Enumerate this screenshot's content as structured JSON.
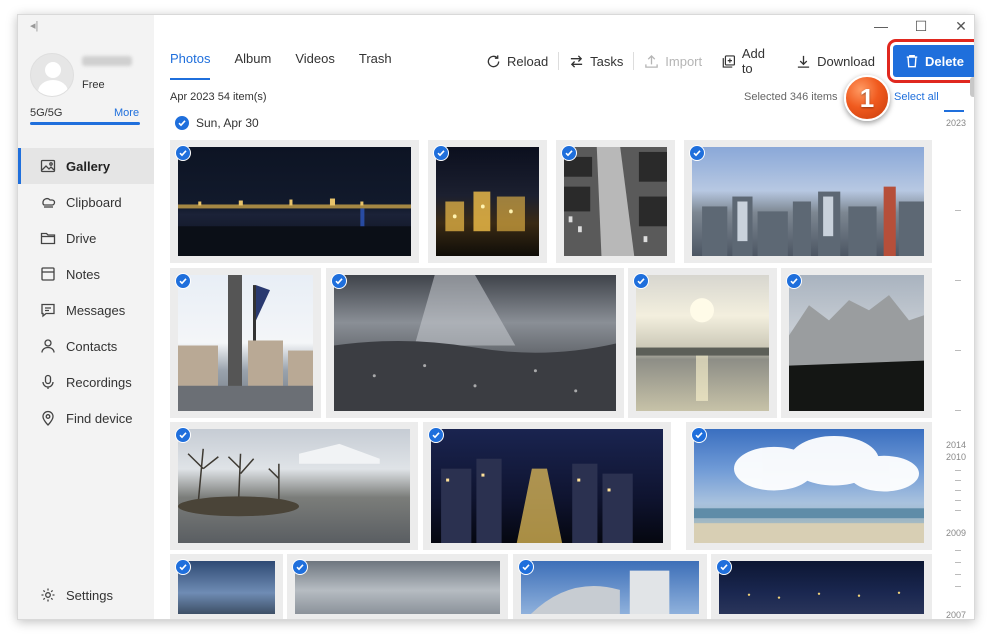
{
  "sidebar": {
    "plan": "Free",
    "storage_label": "5G/5G",
    "storage_more": "More",
    "storage_used_fraction": 1.0,
    "nav": [
      {
        "label": "Gallery",
        "icon": "gallery-icon",
        "active": true
      },
      {
        "label": "Clipboard",
        "icon": "clipboard-icon"
      },
      {
        "label": "Drive",
        "icon": "folder-icon"
      },
      {
        "label": "Notes",
        "icon": "notes-icon"
      },
      {
        "label": "Messages",
        "icon": "message-icon"
      },
      {
        "label": "Contacts",
        "icon": "person-icon"
      },
      {
        "label": "Recordings",
        "icon": "microphone-icon"
      },
      {
        "label": "Find device",
        "icon": "location-icon"
      }
    ],
    "settings_label": "Settings"
  },
  "tabs": [
    {
      "label": "Photos",
      "active": true
    },
    {
      "label": "Album"
    },
    {
      "label": "Videos"
    },
    {
      "label": "Trash"
    }
  ],
  "toolbar": {
    "reload": "Reload",
    "tasks": "Tasks",
    "import": "Import",
    "add_to": "Add to",
    "download": "Download",
    "delete": "Delete"
  },
  "annotation_number": "1",
  "summary": {
    "month_count": "Apr 2023 54 item(s)",
    "selected": "Selected 346 items",
    "select_all": "Select all"
  },
  "date_group": "Sun, Apr 30",
  "timeline_years": [
    "2023",
    "2014",
    "2010",
    "2009",
    "2007"
  ],
  "colors": {
    "accent": "#1f6fdc",
    "annotation_outline": "#e0281f",
    "annotation_badge": "#f05a1e"
  },
  "photos": [
    {
      "subject": "night city skyline by water"
    },
    {
      "subject": "night buildings lights"
    },
    {
      "subject": "aerial street black and white"
    },
    {
      "subject": "city skyline with towers"
    },
    {
      "subject": "harbor street with flags"
    },
    {
      "subject": "cloudy landscape panorama"
    },
    {
      "subject": "sunset over lake"
    },
    {
      "subject": "rocky mountain cliffs"
    },
    {
      "subject": "bare trees by lake"
    },
    {
      "subject": "night city aerial"
    },
    {
      "subject": "beach with clouds"
    },
    {
      "subject": "coastal hills view"
    },
    {
      "subject": "sea horizon view"
    },
    {
      "subject": "modern building"
    },
    {
      "subject": "night harbor lights"
    }
  ]
}
